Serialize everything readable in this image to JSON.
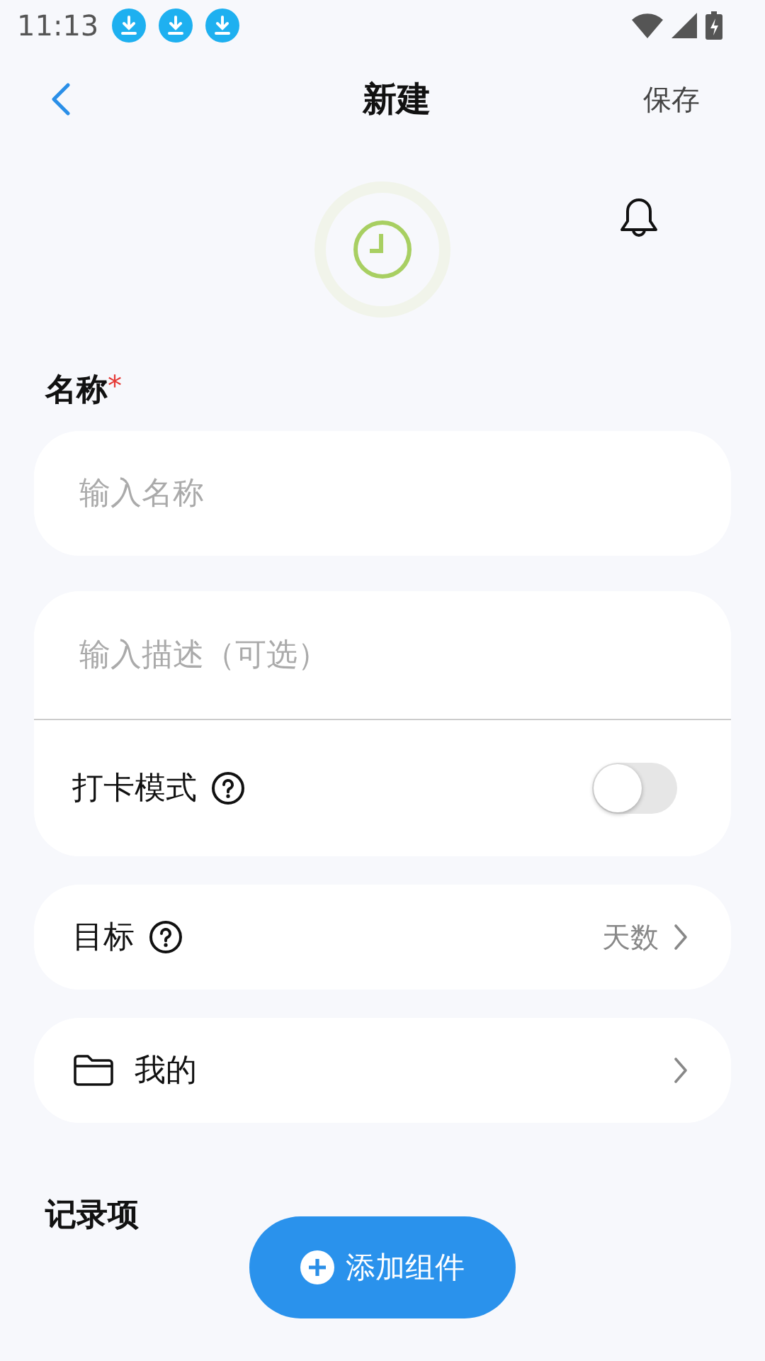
{
  "status_bar": {
    "time": "11:13",
    "notifications": [
      {
        "kind": "download"
      },
      {
        "kind": "download"
      },
      {
        "kind": "download"
      }
    ]
  },
  "header": {
    "title": "新建",
    "action": "保存"
  },
  "name_field": {
    "label": "名称",
    "required_mark": "*",
    "placeholder": "输入名称"
  },
  "details_card": {
    "description_placeholder": "输入描述（可选）",
    "checkin_mode": {
      "label": "打卡模式",
      "on": false
    }
  },
  "goal": {
    "label": "目标",
    "value": "天数"
  },
  "folder": {
    "label": "我的"
  },
  "records_section": {
    "title": "记录项"
  },
  "add_button": {
    "label": "添加组件"
  }
}
